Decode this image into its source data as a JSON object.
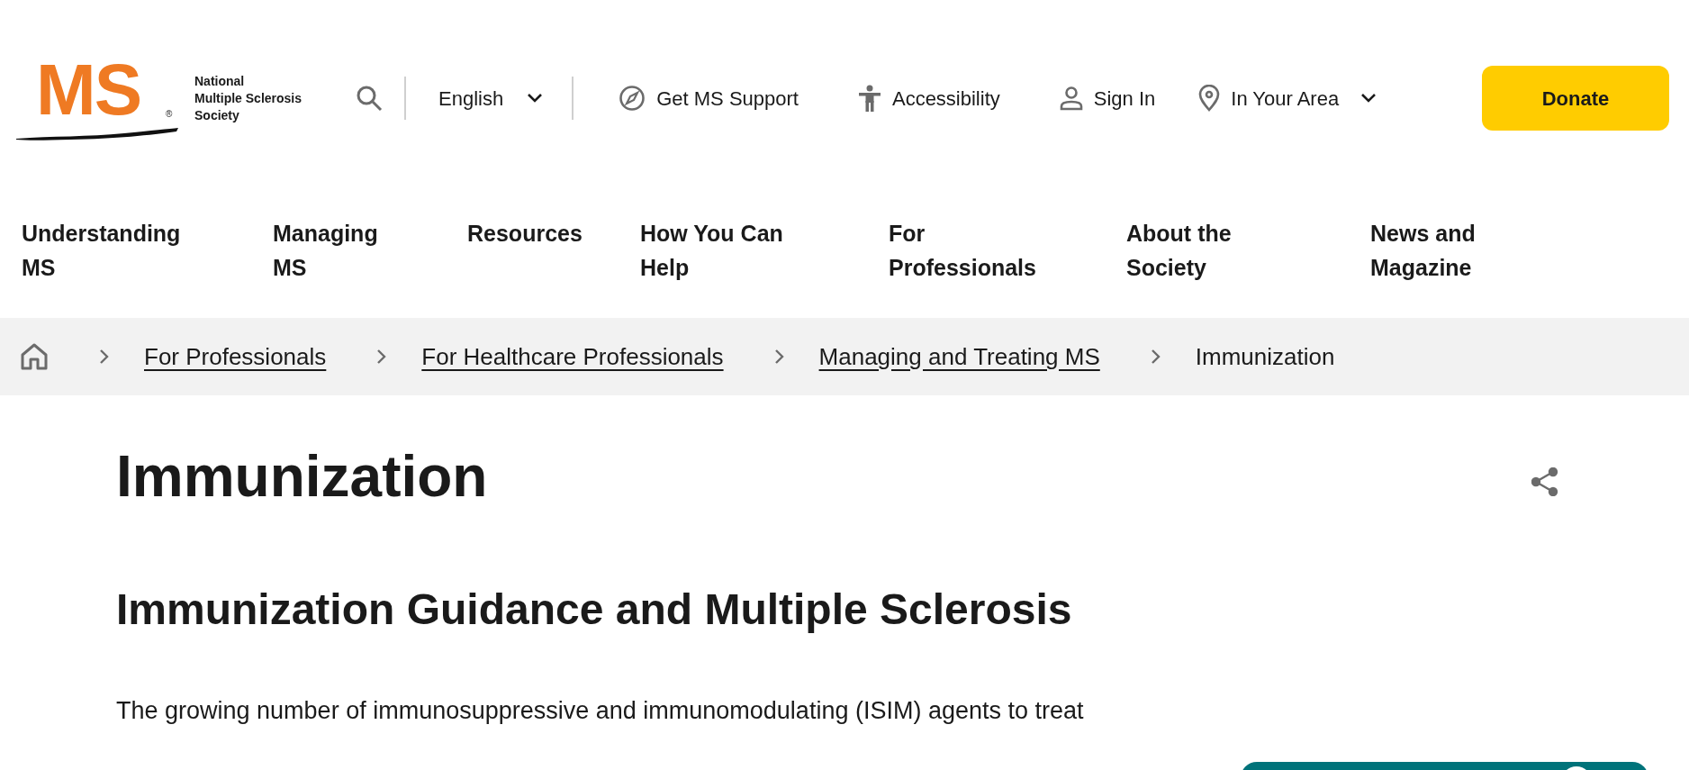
{
  "logo": {
    "mark": "MS",
    "registered": "®",
    "org_name": [
      "National",
      "Multiple Sclerosis",
      "Society"
    ]
  },
  "header": {
    "language": {
      "label": "English"
    },
    "links": [
      {
        "label": "Get MS Support",
        "dropdown": false
      },
      {
        "label": "Accessibility",
        "dropdown": false
      },
      {
        "label": "Sign In",
        "dropdown": false
      },
      {
        "label": "In Your Area",
        "dropdown": true
      }
    ],
    "donate": "Donate"
  },
  "nav": [
    "Understanding MS",
    "Managing MS",
    "Resources",
    "How You Can Help",
    "For Professionals",
    "About the Society",
    "News and Magazine"
  ],
  "breadcrumbs": [
    {
      "label": "For Professionals",
      "current": false
    },
    {
      "label": "For Healthcare Professionals",
      "current": false
    },
    {
      "label": "Managing and Treating MS",
      "current": false
    },
    {
      "label": "Immunization",
      "current": true
    }
  ],
  "page_title": "Immunization",
  "section_heading": "Immunization Guidance and Multiple Sclerosis",
  "paragraph": "The growing number of immunosuppressive and immunomodulating (ISIM) agents to treat"
}
